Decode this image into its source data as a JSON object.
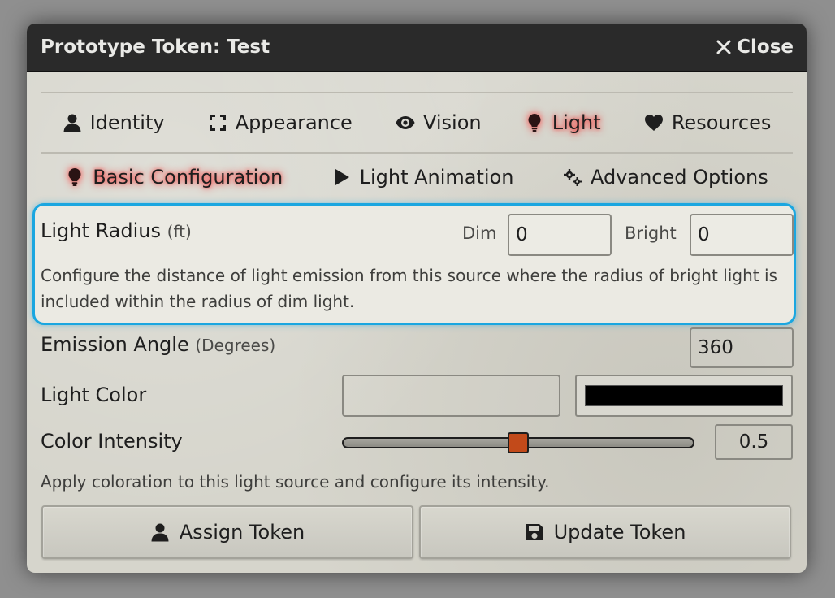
{
  "window": {
    "title": "Prototype Token: Test",
    "close_label": "Close"
  },
  "tabs": [
    {
      "label": "Identity",
      "icon": "user-icon"
    },
    {
      "label": "Appearance",
      "icon": "expand-icon"
    },
    {
      "label": "Vision",
      "icon": "eye-icon"
    },
    {
      "label": "Light",
      "icon": "lightbulb-icon",
      "active": true
    },
    {
      "label": "Resources",
      "icon": "heart-icon"
    }
  ],
  "subtabs": [
    {
      "label": "Basic Configuration",
      "icon": "lightbulb-icon",
      "active": true
    },
    {
      "label": "Light Animation",
      "icon": "play-icon"
    },
    {
      "label": "Advanced Options",
      "icon": "cogs-icon"
    }
  ],
  "light_radius": {
    "label": "Light Radius",
    "unit": "(ft)",
    "dim_label": "Dim",
    "dim_value": "0",
    "bright_label": "Bright",
    "bright_value": "0",
    "hint": "Configure the distance of light emission from this source where the radius of bright light is included within the radius of dim light."
  },
  "emission_angle": {
    "label": "Emission Angle",
    "unit": "(Degrees)",
    "value": "360"
  },
  "light_color": {
    "label": "Light Color",
    "value": "",
    "swatch_color": "#000000"
  },
  "color_intensity": {
    "label": "Color Intensity",
    "value": "0.5",
    "fraction": 0.5,
    "hint": "Apply coloration to this light source and configure its intensity."
  },
  "buttons": {
    "assign": "Assign Token",
    "update": "Update Token"
  },
  "colors": {
    "highlight_border": "#1aa6e0",
    "slider_thumb": "#c24a1a",
    "active_glow": "#ff2a2a"
  }
}
